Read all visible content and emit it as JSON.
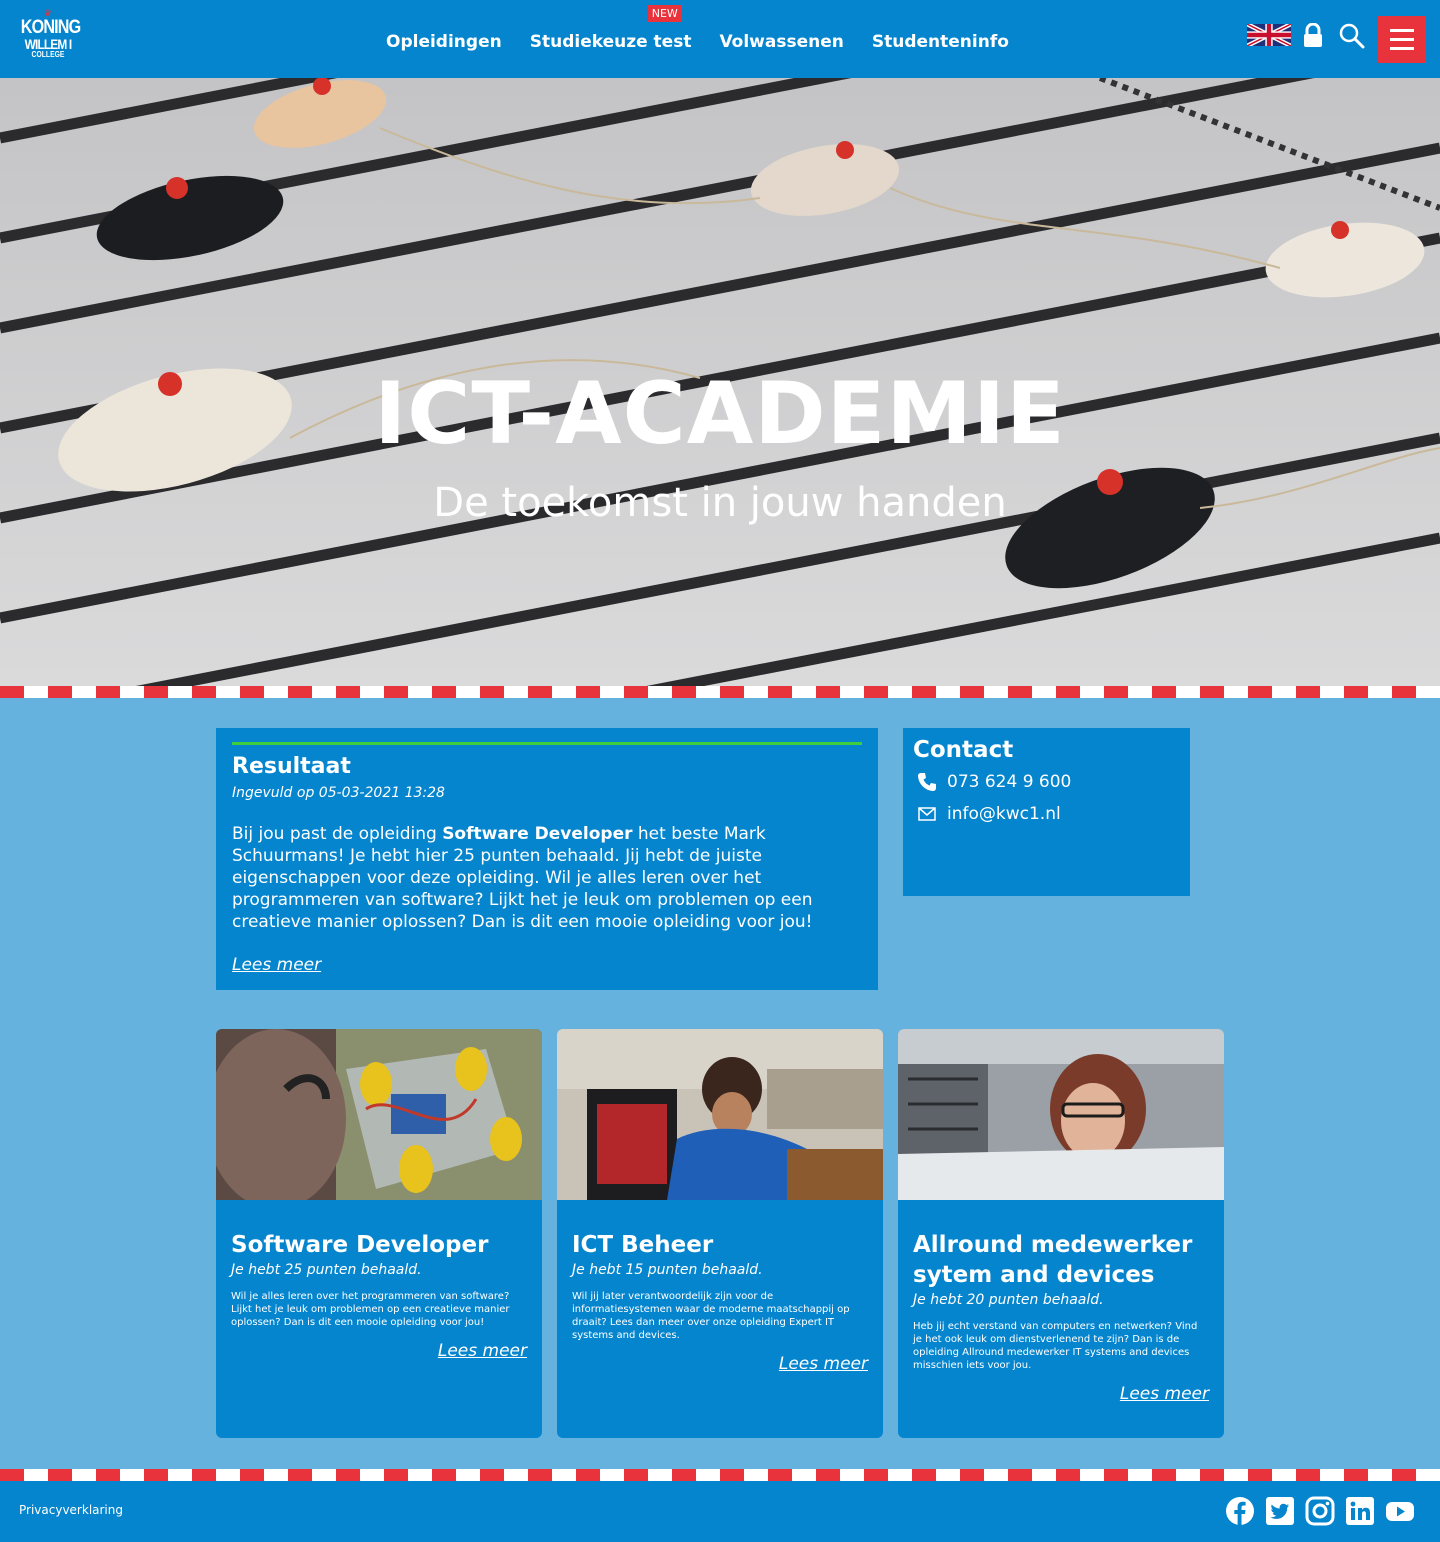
{
  "header": {
    "logo": {
      "line1": "KONING",
      "line2": "WILLEM I",
      "line3": "COLLEGE"
    },
    "nav": [
      {
        "label": "Opleidingen"
      },
      {
        "label": "Studiekeuze test",
        "badge": "NEW"
      },
      {
        "label": "Volwassenen"
      },
      {
        "label": "Studenteninfo"
      }
    ],
    "icons": [
      "uk-flag-icon",
      "lock-icon",
      "search-icon",
      "hamburger-menu-icon"
    ]
  },
  "hero": {
    "title": "ICT-ACADEMIE",
    "subtitle": "De toekomst in jouw handen"
  },
  "result": {
    "title": "Resultaat",
    "date": "Ingevuld op 05-03-2021 13:28",
    "text_before": "Bij jou past de opleiding ",
    "text_bold": "Software Developer",
    "text_after": " het beste Mark Schuurmans! Je hebt hier 25 punten behaald. Jij hebt de juiste eigenschappen voor deze opleiding. Wil je alles leren over het programmeren van software? Lijkt het je leuk om problemen op een creatieve manier oplossen? Dan is dit een mooie opleiding voor jou!",
    "link": "Lees meer"
  },
  "contact": {
    "title": "Contact",
    "phone": "073 624 9 600",
    "email": "info@kwc1.nl"
  },
  "programs": [
    {
      "title": "Software Developer",
      "points": "Je hebt 25 punten behaald.",
      "description": "Wil je alles leren over het programmeren van software? Lijkt het je leuk om problemen op een creatieve manier oplossen? Dan is dit een mooie opleiding voor jou!",
      "link": "Lees meer"
    },
    {
      "title": "ICT Beheer",
      "points": "Je hebt 15 punten behaald.",
      "description": "Wil jij later verantwoordelijk zijn voor de informatiesystemen waar de moderne maatschappij op draait? Lees dan meer over onze opleiding Expert IT systems and devices.",
      "link": "Lees meer"
    },
    {
      "title": "Allround medewerker sytem and devices",
      "points": "Je hebt 20 punten behaald.",
      "description": "Heb jij echt verstand van computers en netwerken? Vind je het ook leuk om dienstverlenend te zijn? Dan is de opleiding Allround medewerker IT systems and devices misschien iets voor jou.",
      "link": "Lees meer"
    }
  ],
  "footer": {
    "privacy": "Privacyverklaring",
    "social": [
      "facebook-icon",
      "twitter-icon",
      "instagram-icon",
      "linkedin-icon",
      "youtube-icon"
    ]
  },
  "colors": {
    "header_blue": "#0585ce",
    "page_blue": "#65b2df",
    "accent_red": "#e8323c",
    "result_bar_green": "#3fcf3e"
  }
}
